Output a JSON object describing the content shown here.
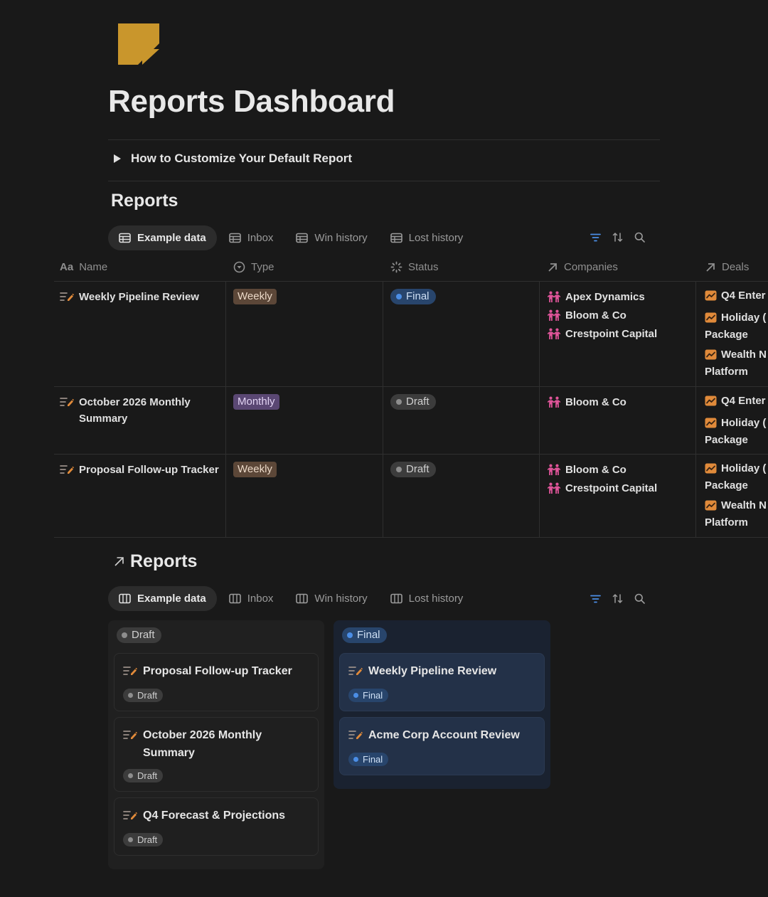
{
  "page": {
    "title": "Reports Dashboard"
  },
  "toggle": {
    "label": "How to Customize Your Default Report"
  },
  "table_section": {
    "title": "Reports",
    "tabs": [
      {
        "label": "Example data",
        "icon": "table-icon",
        "active": true
      },
      {
        "label": "Inbox",
        "icon": "table-icon",
        "active": false
      },
      {
        "label": "Win history",
        "icon": "table-icon",
        "active": false
      },
      {
        "label": "Lost history",
        "icon": "table-icon",
        "active": false
      }
    ],
    "columns": [
      {
        "label": "Name",
        "icon": "text-property-icon"
      },
      {
        "label": "Type",
        "icon": "select-property-icon"
      },
      {
        "label": "Status",
        "icon": "status-property-icon"
      },
      {
        "label": "Companies",
        "icon": "relation-arrow-icon"
      },
      {
        "label": "Deals",
        "icon": "relation-arrow-icon"
      }
    ],
    "rows": [
      {
        "name": "Weekly Pipeline Review",
        "type": "Weekly",
        "status": "Final",
        "companies": [
          "Apex Dynamics",
          "Bloom & Co",
          "Crestpoint Capital"
        ],
        "deals": [
          "Q4 Enter",
          "Holiday (",
          "Package",
          "Wealth N",
          "Platform"
        ]
      },
      {
        "name": "October 2026 Monthly Summary",
        "type": "Monthly",
        "status": "Draft",
        "companies": [
          "Bloom & Co"
        ],
        "deals": [
          "Q4 Enter",
          "Holiday (",
          "Package"
        ]
      },
      {
        "name": "Proposal Follow-up Tracker",
        "type": "Weekly",
        "status": "Draft",
        "companies": [
          "Bloom & Co",
          "Crestpoint Capital"
        ],
        "deals": [
          "Holiday (",
          "Package",
          "Wealth N",
          "Platform"
        ]
      }
    ]
  },
  "board_section": {
    "title": "Reports",
    "tabs": [
      {
        "label": "Example data",
        "icon": "board-icon",
        "active": true
      },
      {
        "label": "Inbox",
        "icon": "board-icon",
        "active": false
      },
      {
        "label": "Win history",
        "icon": "board-icon",
        "active": false
      },
      {
        "label": "Lost history",
        "icon": "board-icon",
        "active": false
      }
    ],
    "groups": [
      {
        "label": "Draft",
        "cards": [
          {
            "title": "Proposal Follow-up Tracker",
            "status": "Draft"
          },
          {
            "title": "October 2026 Monthly Summary",
            "status": "Draft"
          },
          {
            "title": "Q4 Forecast & Projections",
            "status": "Draft"
          }
        ]
      },
      {
        "label": "Final",
        "cards": [
          {
            "title": "Weekly Pipeline Review",
            "status": "Final"
          },
          {
            "title": "Acme Corp Account Review",
            "status": "Final"
          }
        ]
      }
    ]
  },
  "colors": {
    "accent_gold": "#c9962c",
    "filter_blue": "#4b8ee6",
    "company_pink": "#e0559a",
    "deal_orange": "#e08a3a"
  }
}
